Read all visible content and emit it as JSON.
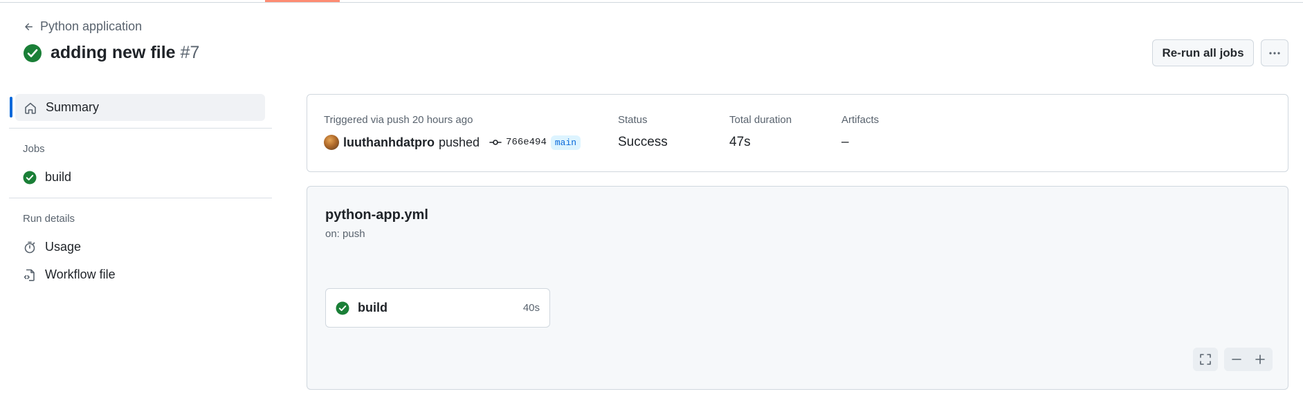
{
  "header": {
    "back_label": "Python application",
    "run_title": "adding new file",
    "run_number": "#7",
    "rerun_label": "Re-run all jobs"
  },
  "sidebar": {
    "summary_label": "Summary",
    "jobs_section": "Jobs",
    "jobs": [
      {
        "label": "build"
      }
    ],
    "run_details_section": "Run details",
    "usage_label": "Usage",
    "workflow_file_label": "Workflow file"
  },
  "summary": {
    "trigger_text": "Triggered via push 20 hours ago",
    "actor": "luuthanhdatpro",
    "action": "pushed",
    "commit": "766e494",
    "branch": "main",
    "status_label": "Status",
    "status_value": "Success",
    "duration_label": "Total duration",
    "duration_value": "47s",
    "artifacts_label": "Artifacts",
    "artifacts_value": "–"
  },
  "graph": {
    "workflow_name": "python-app.yml",
    "trigger": "on: push",
    "job_name": "build",
    "job_duration": "40s"
  },
  "colors": {
    "success": "#1a7f37",
    "accent": "#0969da",
    "tab_underline": "#fd8c73"
  }
}
